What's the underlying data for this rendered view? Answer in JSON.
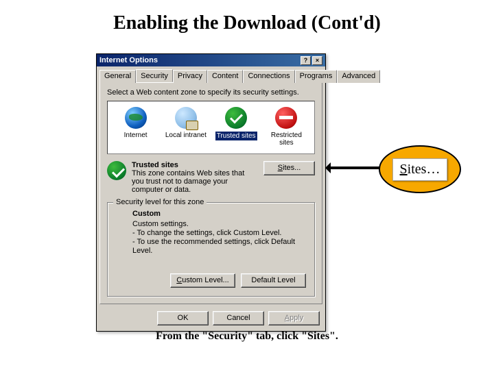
{
  "slide": {
    "title": "Enabling the Download (Cont'd)",
    "caption": "From the \"Security\" tab, click \"Sites\"."
  },
  "dialog": {
    "title": "Internet Options",
    "help_btn": "?",
    "close_btn": "×",
    "tabs": [
      "General",
      "Security",
      "Privacy",
      "Content",
      "Connections",
      "Programs",
      "Advanced"
    ],
    "active_tab": "Security",
    "instruction": "Select a Web content zone to specify its security settings.",
    "zones": [
      {
        "label": "Internet",
        "icon": "globe"
      },
      {
        "label": "Local intranet",
        "icon": "intranet"
      },
      {
        "label": "Trusted sites",
        "icon": "check",
        "selected": true
      },
      {
        "label": "Restricted sites",
        "icon": "restricted"
      }
    ],
    "trusted": {
      "heading": "Trusted sites",
      "desc": "This zone contains Web sites that you trust not to damage your computer or data.",
      "sites_btn": "Sites..."
    },
    "level": {
      "legend": "Security level for this zone",
      "name": "Custom",
      "line1": "Custom settings.",
      "line2": "- To change the settings, click Custom Level.",
      "line3": "- To use the recommended settings, click Default Level.",
      "custom_btn": "Custom Level...",
      "default_btn": "Default Level"
    },
    "buttons": {
      "ok": "OK",
      "cancel": "Cancel",
      "apply": "Apply"
    }
  },
  "callout": {
    "label": "Sites…"
  }
}
